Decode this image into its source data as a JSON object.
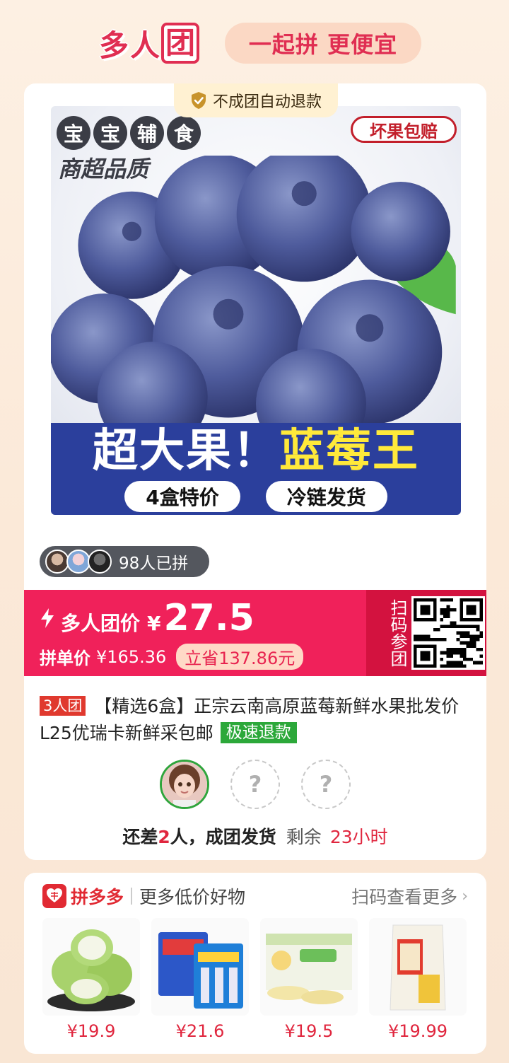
{
  "header": {
    "logo_chars": [
      "多",
      "人",
      "团"
    ],
    "slogan": "一起拼 更便宜"
  },
  "product": {
    "refund_tag": "不成团自动退款",
    "image": {
      "badge_left": [
        "宝",
        "宝",
        "辅",
        "食"
      ],
      "sub": "商超品质",
      "badge_right": "坏果包赔",
      "headline_white": "超大果！",
      "headline_yellow": "蓝莓王",
      "pills": [
        "4盒特价",
        "冷链发货"
      ]
    },
    "joined_text": "98人已拼",
    "price": {
      "label": "多人团价",
      "currency": "¥",
      "value": "27.5",
      "orig_label": "拼单价",
      "orig_price": "¥165.36",
      "save": "立省137.86元",
      "scan": "扫码参团"
    },
    "group_tag": "3人团",
    "title": "【精选6盒】正宗云南高原蓝莓新鲜水果批发价L25优瑞卡新鲜采包邮",
    "fast_refund": "极速退款",
    "member_placeholder": "?",
    "remain": {
      "prefix": "还差",
      "count": "2",
      "suffix": "人，成团发货",
      "left_label": "剩余",
      "time": "23小时"
    }
  },
  "more": {
    "brand": "拼多多",
    "subtitle": "更多低价好物",
    "scan_more": "扫码查看更多",
    "chevron": "›",
    "items": [
      {
        "price": "¥19.9",
        "icon": "guava"
      },
      {
        "price": "¥21.6",
        "icon": "gum-packs"
      },
      {
        "price": "¥19.5",
        "icon": "corn-box"
      },
      {
        "price": "¥19.99",
        "icon": "rice-bag"
      }
    ]
  },
  "colors": {
    "accent": "#f0215a",
    "brand_red": "#e12a33",
    "green": "#2ca83a"
  }
}
